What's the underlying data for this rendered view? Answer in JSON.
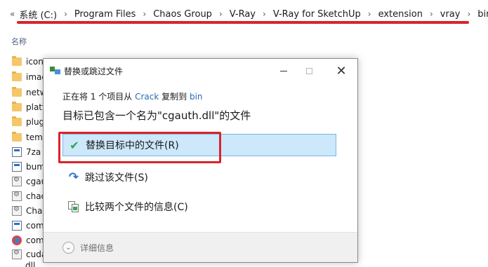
{
  "address": {
    "chevron": "«",
    "crumbs": [
      "系统 (C:)",
      "Program Files",
      "Chaos Group",
      "V-Ray",
      "V-Ray for SketchUp",
      "extension",
      "vray",
      "bin"
    ],
    "separator": "›"
  },
  "columns": {
    "name_label": "名称"
  },
  "files": [
    {
      "name": "icon",
      "icon": "folder-icon"
    },
    {
      "name": "imag",
      "icon": "folder-icon"
    },
    {
      "name": "netw",
      "icon": "folder-icon"
    },
    {
      "name": "platf",
      "icon": "folder-icon"
    },
    {
      "name": "plug",
      "icon": "folder-icon"
    },
    {
      "name": "temp",
      "icon": "folder-icon"
    },
    {
      "name": "7za",
      "icon": "exe-icon"
    },
    {
      "name": "bum",
      "icon": "exe-icon"
    },
    {
      "name": "cgau",
      "icon": "dll-icon"
    },
    {
      "name": "chac",
      "icon": "dll-icon"
    },
    {
      "name": "Chac",
      "icon": "dll-icon"
    },
    {
      "name": "com",
      "icon": "exe-icon"
    },
    {
      "name": "com",
      "icon": "app-icon"
    },
    {
      "name": "cuda",
      "icon": "dll-icon"
    }
  ],
  "dialog": {
    "title": "替换或跳过文件",
    "controls": {
      "minimize": "–",
      "maximize": "□",
      "close": "✕"
    },
    "copy_line": {
      "prefix": "正在将 1 个项目从 ",
      "source": "Crack",
      "middle": " 复制到 ",
      "dest": "bin"
    },
    "message": "目标已包含一个名为\"cgauth.dll\"的文件",
    "options": {
      "replace": {
        "label": "替换目标中的文件(R)",
        "icon": "checkmark-icon"
      },
      "skip": {
        "label": "跳过该文件(S)",
        "icon": "skip-arrow-icon"
      },
      "compare": {
        "label": "比较两个文件的信息(C)",
        "icon": "compare-files-icon"
      }
    },
    "more_details": {
      "label": "详细信息",
      "icon": "chevron-down-circle-icon"
    }
  },
  "peek_text": "dll"
}
